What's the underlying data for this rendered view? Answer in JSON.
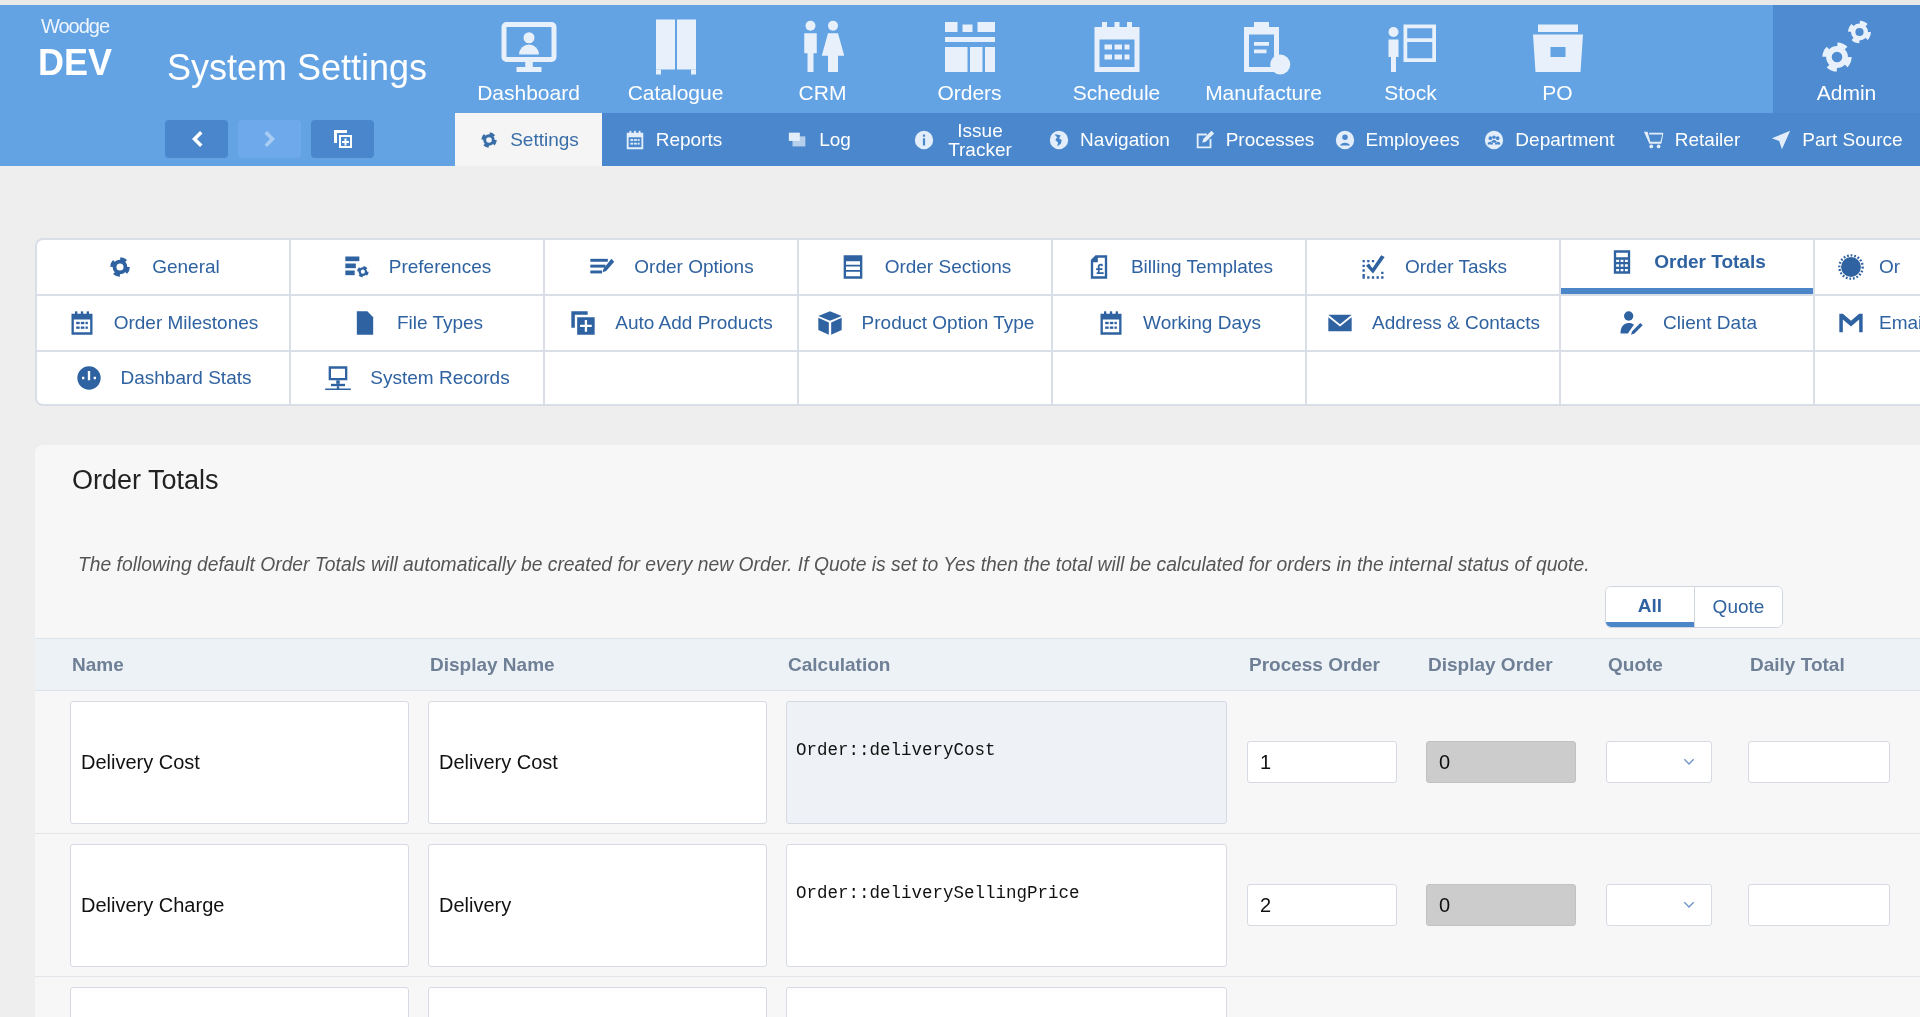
{
  "app": {
    "logo_brand": "Woodge",
    "logo_env": "DEV",
    "title": "System Settings"
  },
  "history_buttons": [
    {
      "kind": "back",
      "disabled": false
    },
    {
      "kind": "forward",
      "disabled": true
    },
    {
      "kind": "new_window",
      "disabled": false
    }
  ],
  "main_nav": [
    {
      "label": "Dashboard",
      "selected": false
    },
    {
      "label": "Catalogue",
      "selected": false
    },
    {
      "label": "CRM",
      "selected": false
    },
    {
      "label": "Orders",
      "selected": false
    },
    {
      "label": "Schedule",
      "selected": false
    },
    {
      "label": "Manufacture",
      "selected": false
    },
    {
      "label": "Stock",
      "selected": false
    },
    {
      "label": "PO",
      "selected": false
    },
    {
      "label": "Admin",
      "selected": true
    }
  ],
  "sub_nav": [
    {
      "label": "Settings",
      "selected": true
    },
    {
      "label": "Reports",
      "selected": false
    },
    {
      "label": "Log",
      "selected": false
    },
    {
      "label": "Issue Tracker",
      "selected": false
    },
    {
      "label": "Navigation",
      "selected": false
    },
    {
      "label": "Processes",
      "selected": false
    },
    {
      "label": "Employees",
      "selected": false
    },
    {
      "label": "Department",
      "selected": false
    },
    {
      "label": "Retailer",
      "selected": false
    },
    {
      "label": "Part Source",
      "selected": false
    }
  ],
  "settings_tabs": [
    {
      "label": "General",
      "selected": false
    },
    {
      "label": "Preferences",
      "selected": false
    },
    {
      "label": "Order Options",
      "selected": false
    },
    {
      "label": "Order Sections",
      "selected": false
    },
    {
      "label": "Billing Templates",
      "selected": false
    },
    {
      "label": "Order Tasks",
      "selected": false
    },
    {
      "label": "Order Totals",
      "selected": true
    },
    {
      "label": "Or",
      "selected": false
    },
    {
      "label": "Order Milestones",
      "selected": false
    },
    {
      "label": "File Types",
      "selected": false
    },
    {
      "label": "Auto Add Products",
      "selected": false
    },
    {
      "label": "Product Option Type",
      "selected": false
    },
    {
      "label": "Working Days",
      "selected": false
    },
    {
      "label": "Address & Contacts",
      "selected": false
    },
    {
      "label": "Client Data",
      "selected": false
    },
    {
      "label": "Emai",
      "selected": false
    },
    {
      "label": "Dashbard Stats",
      "selected": false
    },
    {
      "label": "System Records",
      "selected": false
    }
  ],
  "order_totals": {
    "title": "Order Totals",
    "description": "The following default Order Totals will automatically be created for every new Order. If Quote is set to Yes then the total will be calculated for orders in the internal status of quote.",
    "filter": [
      {
        "label": "All",
        "selected": true
      },
      {
        "label": "Quote",
        "selected": false
      }
    ],
    "columns": [
      "Name",
      "Display Name",
      "Calculation",
      "Process Order",
      "Display Order",
      "Quote",
      "Daily Total"
    ],
    "rows": [
      {
        "name": "Delivery Cost",
        "display_name": "Delivery Cost",
        "calculation": "Order::deliveryCost",
        "calculation_readonly": true,
        "process_order": "1",
        "display_order": "0",
        "display_order_disabled": true
      },
      {
        "name": "Delivery Charge",
        "display_name": "Delivery",
        "calculation": "Order::deliverySellingPrice",
        "calculation_readonly": false,
        "process_order": "2",
        "display_order": "0",
        "display_order_disabled": true
      },
      {
        "calculation_readonly": false
      }
    ]
  }
}
